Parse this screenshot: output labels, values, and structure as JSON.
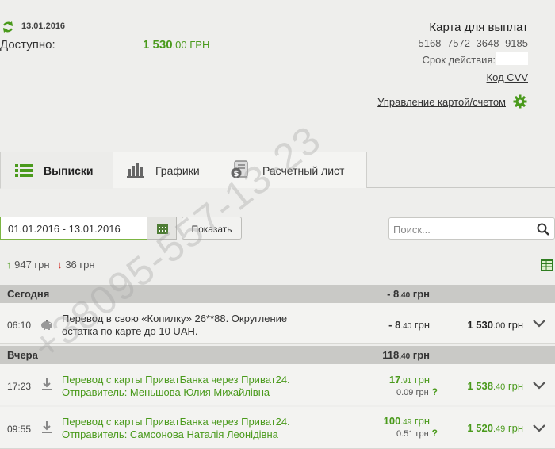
{
  "header": {
    "date": "13.01.2016",
    "available_label": "Доступно:",
    "available_int": "1 530",
    "available_dec": ".00 ГРН"
  },
  "card": {
    "title": "Карта для выплат",
    "number": "5168 7572 3648 9185",
    "expiry_label": "Срок действия:",
    "cvv_link": "Код CVV",
    "manage_link": "Управление картой/счетом"
  },
  "tabs": [
    {
      "label": "Выписки",
      "icon": "list-icon",
      "active": true
    },
    {
      "label": "Графики",
      "icon": "bar-chart-icon",
      "active": false
    },
    {
      "label": "Расчетный лист",
      "icon": "payslip-icon",
      "active": false
    }
  ],
  "filters": {
    "date_range": "01.01.2016 - 13.01.2016",
    "show_button": "Показать",
    "search_placeholder": "Поиск..."
  },
  "totals": {
    "income": "947 грн",
    "expense": "36 грн"
  },
  "days": [
    {
      "name": "Сегодня",
      "sum_int": "- 8",
      "sum_dec": ".40",
      "sum_cur": " грн",
      "transactions": [
        {
          "time": "06:10",
          "icon": "piggy-bank-icon",
          "desc_line1": "Перевод в свою «Копилку» 26**88. Округление",
          "desc_line2": "остатка по карте до 10 UAH.",
          "amount_int": "- 8",
          "amount_dec": ".40",
          "amount_cur": " грн",
          "balance_int": "1 530",
          "balance_dec": ".00",
          "balance_cur": " грн"
        }
      ]
    },
    {
      "name": "Вчера",
      "sum_int": "118",
      "sum_dec": ".40",
      "sum_cur": " грн",
      "transactions": [
        {
          "time": "17:23",
          "icon": "download-icon",
          "desc_line1": "Перевод с карты ПриватБанка через Приват24.",
          "desc_line2": "Отправитель: Меньшова Юлия Михайлівна",
          "amount_int": "17",
          "amount_dec": ".91",
          "amount_cur": " грн",
          "fee": "0.09 грн",
          "fee_q": "?",
          "balance_int": "1 538",
          "balance_dec": ".40",
          "balance_cur": " грн"
        },
        {
          "time": "09:55",
          "icon": "download-icon",
          "desc_line1": "Перевод с карты ПриватБанка через Приват24.",
          "desc_line2": "Отправитель: Самсонова Наталія Леонідівна",
          "amount_int": "100",
          "amount_dec": ".49",
          "amount_cur": " грн",
          "fee": "0.51 грн",
          "fee_q": "?",
          "balance_int": "1 520",
          "balance_dec": ".49",
          "balance_cur": " грн"
        }
      ]
    }
  ],
  "watermark": "+38095-557-13-23",
  "colors": {
    "accent_green": "#4a9a1c",
    "expense_red": "#d0322c",
    "background": "#eeeeec"
  }
}
